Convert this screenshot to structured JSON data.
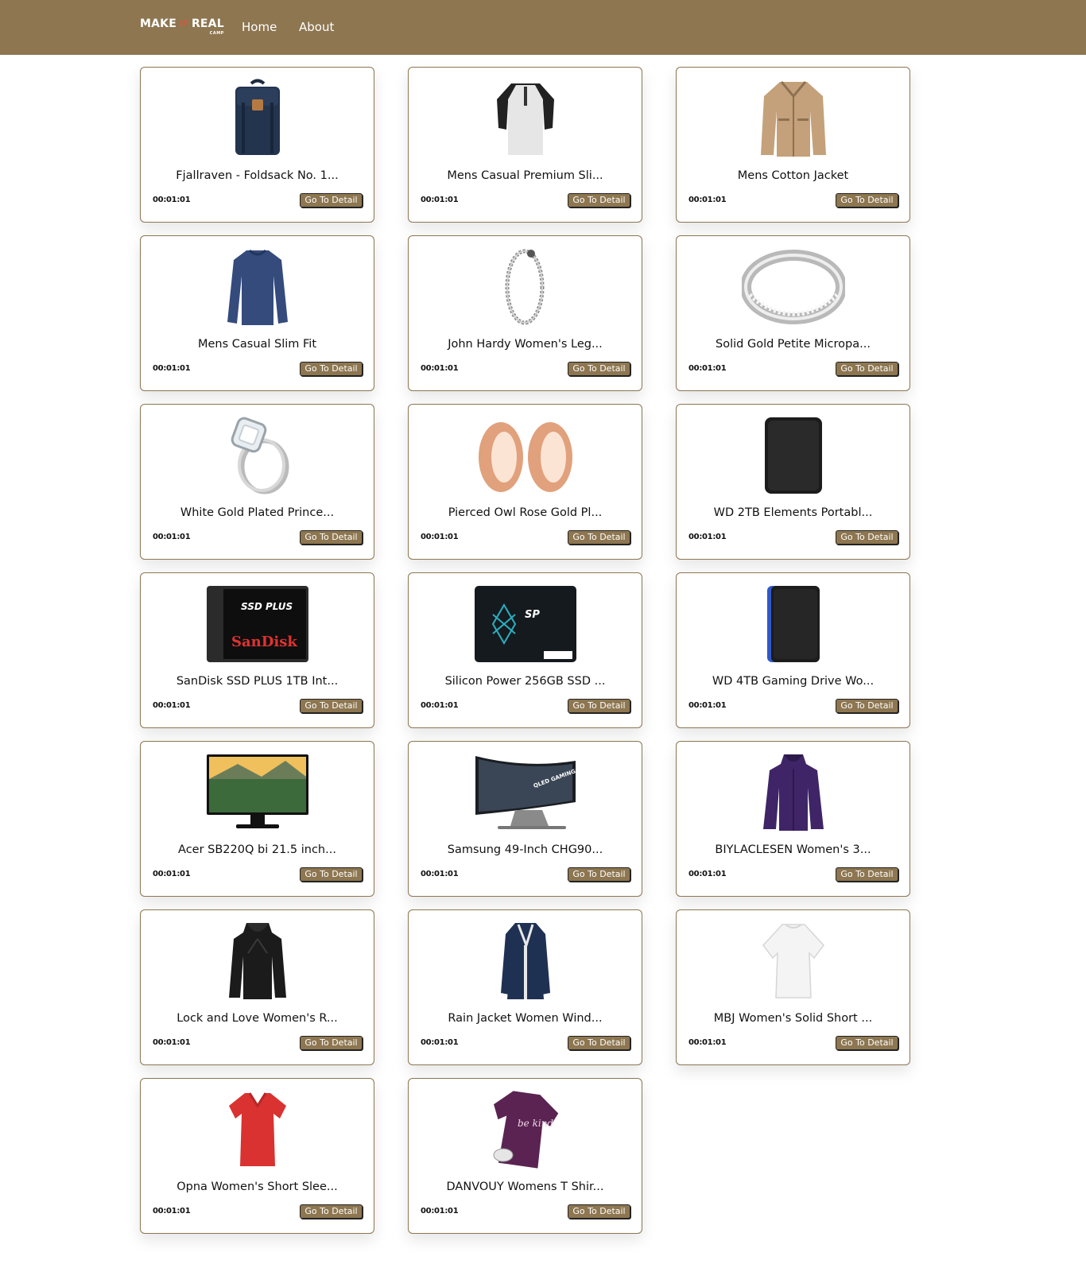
{
  "nav": {
    "logo": {
      "make": "MAKE",
      "it": "IT",
      "real": "REAL",
      "camp": "CAMP"
    },
    "home": "Home",
    "about": "About"
  },
  "colors": {
    "brand": "#8d7650",
    "logo_accent": "#e8503a"
  },
  "products": [
    {
      "title": "Fjallraven - Foldsack No. 1...",
      "time": "00:01:01",
      "button": "Go To Detail",
      "icon": "backpack-icon"
    },
    {
      "title": "Mens Casual Premium Sli...",
      "time": "00:01:01",
      "button": "Go To Detail",
      "icon": "tshirt-icon"
    },
    {
      "title": "Mens Cotton Jacket",
      "time": "00:01:01",
      "button": "Go To Detail",
      "icon": "jacket-icon"
    },
    {
      "title": "Mens Casual Slim Fit",
      "time": "00:01:01",
      "button": "Go To Detail",
      "icon": "longsleeve-icon"
    },
    {
      "title": "John Hardy Women's Leg...",
      "time": "00:01:01",
      "button": "Go To Detail",
      "icon": "bracelet-icon"
    },
    {
      "title": "Solid Gold Petite Micropa...",
      "time": "00:01:01",
      "button": "Go To Detail",
      "icon": "ring-icon"
    },
    {
      "title": "White Gold Plated Prince...",
      "time": "00:01:01",
      "button": "Go To Detail",
      "icon": "diamond-ring-icon"
    },
    {
      "title": "Pierced Owl Rose Gold Pl...",
      "time": "00:01:01",
      "button": "Go To Detail",
      "icon": "plugs-icon"
    },
    {
      "title": "WD 2TB Elements Portabl...",
      "time": "00:01:01",
      "button": "Go To Detail",
      "icon": "hard-drive-icon"
    },
    {
      "title": "SanDisk SSD PLUS 1TB Int...",
      "time": "00:01:01",
      "button": "Go To Detail",
      "icon": "ssd-sandisk-icon",
      "label_top": "SSD PLUS",
      "label_brand": "SanDisk"
    },
    {
      "title": "Silicon Power 256GB SSD ...",
      "time": "00:01:01",
      "button": "Go To Detail",
      "icon": "ssd-sp-icon",
      "label_brand": "SP"
    },
    {
      "title": "WD 4TB Gaming Drive Wo...",
      "time": "00:01:01",
      "button": "Go To Detail",
      "icon": "gaming-drive-icon"
    },
    {
      "title": "Acer SB220Q bi 21.5 inch...",
      "time": "00:01:01",
      "button": "Go To Detail",
      "icon": "monitor-icon"
    },
    {
      "title": "Samsung 49-Inch CHG90...",
      "time": "00:01:01",
      "button": "Go To Detail",
      "icon": "curved-monitor-icon",
      "label_top": "QLED GAMING MONITOR"
    },
    {
      "title": "BIYLACLESEN Women's 3...",
      "time": "00:01:01",
      "button": "Go To Detail",
      "icon": "purple-jacket-icon"
    },
    {
      "title": "Lock and Love Women's R...",
      "time": "00:01:01",
      "button": "Go To Detail",
      "icon": "leather-jacket-icon"
    },
    {
      "title": "Rain Jacket Women Wind...",
      "time": "00:01:01",
      "button": "Go To Detail",
      "icon": "rain-jacket-icon"
    },
    {
      "title": "MBJ Women's Solid Short ...",
      "time": "00:01:01",
      "button": "Go To Detail",
      "icon": "white-top-icon"
    },
    {
      "title": "Opna Women's Short Slee...",
      "time": "00:01:01",
      "button": "Go To Detail",
      "icon": "red-tshirt-icon"
    },
    {
      "title": "DANVOUY Womens T Shir...",
      "time": "00:01:01",
      "button": "Go To Detail",
      "icon": "purple-tshirt-icon",
      "label_top": "be kind"
    }
  ]
}
